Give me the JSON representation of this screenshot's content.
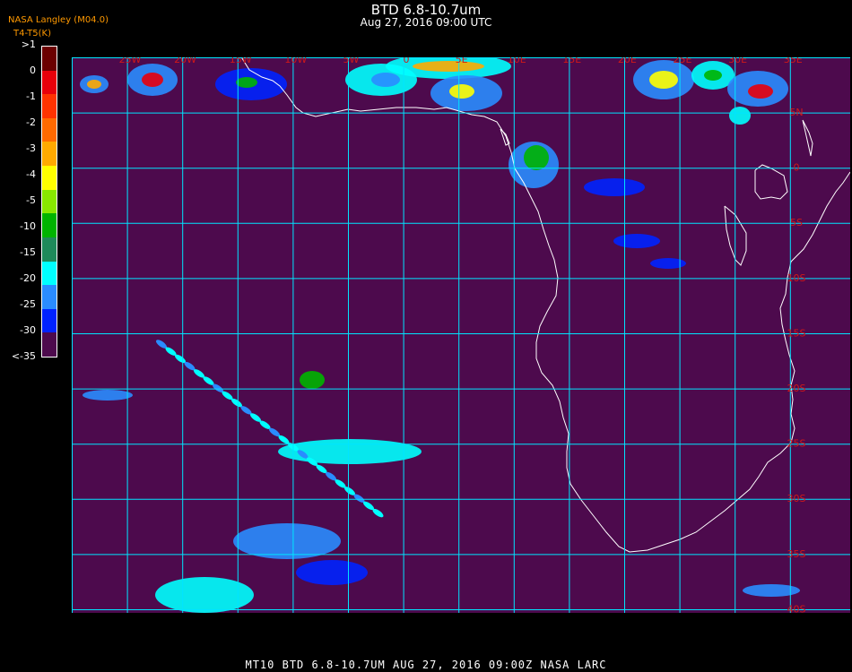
{
  "title": "BTD 6.8-10.7um",
  "subtitle": "Aug 27, 2016 09:00 UTC",
  "organization": "NASA Langley (M04.0)",
  "legend_units": "T4-T5(K)",
  "legend": [
    {
      "label": ">1",
      "color": "#6b0000"
    },
    {
      "label": "0",
      "color": "#e8000a"
    },
    {
      "label": "-1",
      "color": "#ff3300"
    },
    {
      "label": "-2",
      "color": "#ff6a00"
    },
    {
      "label": "-3",
      "color": "#ffaa00"
    },
    {
      "label": "-4",
      "color": "#ffff00"
    },
    {
      "label": "-5",
      "color": "#88e800"
    },
    {
      "label": "-10",
      "color": "#00b400"
    },
    {
      "label": "-15",
      "color": "#1f8a5a"
    },
    {
      "label": "-20",
      "color": "#00ffff"
    },
    {
      "label": "-25",
      "color": "#2a8cff"
    },
    {
      "label": "-30",
      "color": "#0022ff"
    },
    {
      "label": "<-35",
      "color": "#4d0a4d"
    }
  ],
  "map": {
    "background_color": "#4d0a4d",
    "grid_color": "#00e5ff",
    "coast_color": "#ffffff",
    "longitude_labels": [
      "25W",
      "20W",
      "15W",
      "10W",
      "5W",
      "0",
      "5E",
      "10E",
      "15E",
      "20E",
      "25E",
      "30E",
      "35E"
    ],
    "latitude_labels": [
      "5N",
      "0",
      "5S",
      "10S",
      "15S",
      "20S",
      "25S",
      "30S",
      "35S",
      "40S"
    ]
  },
  "footer": "MT10  BTD 6.8-10.7UM   AUG 27, 2016 09:00Z   NASA LARC"
}
